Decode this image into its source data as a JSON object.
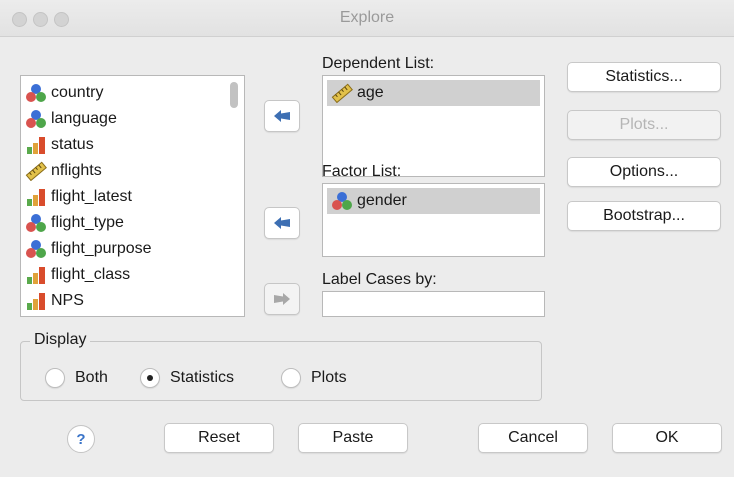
{
  "window": {
    "title": "Explore"
  },
  "variables": [
    {
      "name": "country",
      "icon": "nominal-icon"
    },
    {
      "name": "language",
      "icon": "nominal-icon"
    },
    {
      "name": "status",
      "icon": "ordinal-icon"
    },
    {
      "name": "nflights",
      "icon": "scale-icon"
    },
    {
      "name": "flight_latest",
      "icon": "ordinal-icon"
    },
    {
      "name": "flight_type",
      "icon": "nominal-icon"
    },
    {
      "name": "flight_purpose",
      "icon": "nominal-icon"
    },
    {
      "name": "flight_class",
      "icon": "ordinal-icon"
    },
    {
      "name": "NPS",
      "icon": "ordinal-icon"
    }
  ],
  "dependent": {
    "label": "Dependent List:",
    "items": [
      {
        "name": "age",
        "icon": "scale-icon"
      }
    ]
  },
  "factor": {
    "label": "Factor List:",
    "items": [
      {
        "name": "gender",
        "icon": "nominal-icon"
      }
    ]
  },
  "label_cases": {
    "label": "Label Cases by:",
    "value": ""
  },
  "side_buttons": {
    "statistics": "Statistics...",
    "plots": "Plots...",
    "options": "Options...",
    "bootstrap": "Bootstrap..."
  },
  "display": {
    "legend": "Display",
    "both": "Both",
    "statistics": "Statistics",
    "plots": "Plots",
    "selected": "Statistics"
  },
  "footer": {
    "help": "?",
    "reset": "Reset",
    "paste": "Paste",
    "cancel": "Cancel",
    "ok": "OK"
  },
  "colors": {
    "nominal_red": "#d9534f",
    "nominal_blue": "#3b6fd6",
    "nominal_green": "#4ea64a",
    "ordinal_red": "#d94c2c",
    "ordinal_green": "#5aaa4c",
    "ruler": "#e2c14a",
    "arrow_blue": "#3d6fb3"
  }
}
